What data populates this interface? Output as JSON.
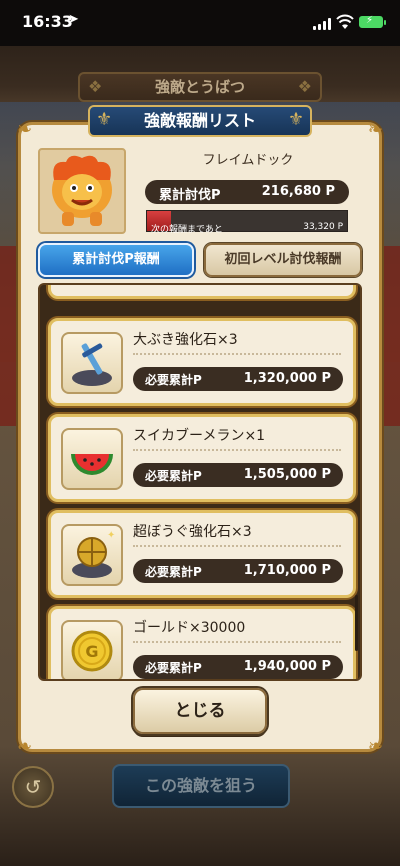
{
  "status_bar": {
    "time": "16:33",
    "location_glyph": "➤",
    "battery_color": "#4cd964"
  },
  "background": {
    "top_title": "強敵とうばつ",
    "target_button": "この強敵を狙う",
    "back_icon": "undo-arrow-icon"
  },
  "panel": {
    "title": "強敵報酬リスト",
    "enemy_name": "フレイムドック",
    "total_label": "累計討伐P",
    "total_value": "216,680 P",
    "next_label": "次の報酬まであと",
    "next_value": "33,320 P",
    "progress_fraction": 0.12,
    "tabs": [
      {
        "label": "累計討伐P報酬",
        "active": true
      },
      {
        "label": "初回レベル討伐報酬",
        "active": false
      }
    ],
    "close_button": "とじる",
    "accent_gold": "#e0be60",
    "accent_blue": "#1f6fc4"
  },
  "rewards": [
    {
      "name": "大ぶき強化石×3",
      "req_label": "必要累計P",
      "req_value": "1,320,000 P",
      "icon": "sword-stone-icon"
    },
    {
      "name": "スイカブーメラン×1",
      "req_label": "必要累計P",
      "req_value": "1,505,000 P",
      "icon": "watermelon-icon"
    },
    {
      "name": "超ぼうぐ強化石×3",
      "req_label": "必要累計P",
      "req_value": "1,710,000 P",
      "icon": "shield-stone-icon"
    },
    {
      "name": "ゴールド×30000",
      "req_label": "必要累計P",
      "req_value": "1,940,000 P",
      "icon": "gold-coin-icon"
    }
  ]
}
